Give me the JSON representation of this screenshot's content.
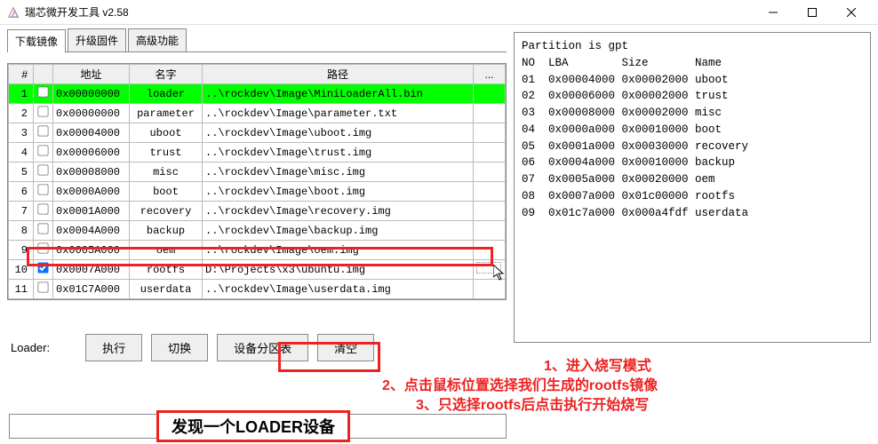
{
  "window": {
    "title": "瑞芯微开发工具 v2.58"
  },
  "tabs": [
    {
      "label": "下载镜像",
      "active": true
    },
    {
      "label": "升级固件",
      "active": false
    },
    {
      "label": "高级功能",
      "active": false
    }
  ],
  "table": {
    "headers": {
      "num": "#",
      "chk": "",
      "addr": "地址",
      "name": "名字",
      "path": "路径",
      "ext": "..."
    },
    "rows": [
      {
        "n": "1",
        "chk": false,
        "addr": "0x00000000",
        "name": "loader",
        "path": "..\\rockdev\\Image\\MiniLoaderAll.bin",
        "selected": true
      },
      {
        "n": "2",
        "chk": false,
        "addr": "0x00000000",
        "name": "parameter",
        "path": "..\\rockdev\\Image\\parameter.txt"
      },
      {
        "n": "3",
        "chk": false,
        "addr": "0x00004000",
        "name": "uboot",
        "path": "..\\rockdev\\Image\\uboot.img"
      },
      {
        "n": "4",
        "chk": false,
        "addr": "0x00006000",
        "name": "trust",
        "path": "..\\rockdev\\Image\\trust.img"
      },
      {
        "n": "5",
        "chk": false,
        "addr": "0x00008000",
        "name": "misc",
        "path": "..\\rockdev\\Image\\misc.img"
      },
      {
        "n": "6",
        "chk": false,
        "addr": "0x0000A000",
        "name": "boot",
        "path": "..\\rockdev\\Image\\boot.img"
      },
      {
        "n": "7",
        "chk": false,
        "addr": "0x0001A000",
        "name": "recovery",
        "path": "..\\rockdev\\Image\\recovery.img"
      },
      {
        "n": "8",
        "chk": false,
        "addr": "0x0004A000",
        "name": "backup",
        "path": "..\\rockdev\\Image\\backup.img"
      },
      {
        "n": "9",
        "chk": false,
        "addr": "0x0005A000",
        "name": "oem",
        "path": "..\\rockdev\\Image\\oem.img"
      },
      {
        "n": "10",
        "chk": true,
        "addr": "0x0007A000",
        "name": "rootfs",
        "path": "D:\\Projects\\x3\\ubuntu.img",
        "dotted": true
      },
      {
        "n": "11",
        "chk": false,
        "addr": "0x01C7A000",
        "name": "userdata",
        "path": "..\\rockdev\\Image\\userdata.img"
      }
    ]
  },
  "footer": {
    "label": "Loader:",
    "buttons": {
      "run": "执行",
      "switch": "切换",
      "partition": "设备分区表",
      "clear": "清空"
    }
  },
  "partition_log": {
    "title": "Partition is gpt",
    "header": "NO  LBA        Size       Name",
    "lines": [
      "01  0x00004000 0x00002000 uboot",
      "02  0x00006000 0x00002000 trust",
      "03  0x00008000 0x00002000 misc",
      "04  0x0000a000 0x00010000 boot",
      "05  0x0001a000 0x00030000 recovery",
      "06  0x0004a000 0x00010000 backup",
      "07  0x0005a000 0x00020000 oem",
      "08  0x0007a000 0x01c00000 rootfs",
      "09  0x01c7a000 0x000a4fdf userdata"
    ]
  },
  "status": {
    "text": "发现一个LOADER设备"
  },
  "annotations": {
    "a1": "1、进入烧写模式",
    "a2": "2、点击鼠标位置选择我们生成的rootfs镜像",
    "a3": "3、只选择rootfs后点击执行开始烧写"
  }
}
